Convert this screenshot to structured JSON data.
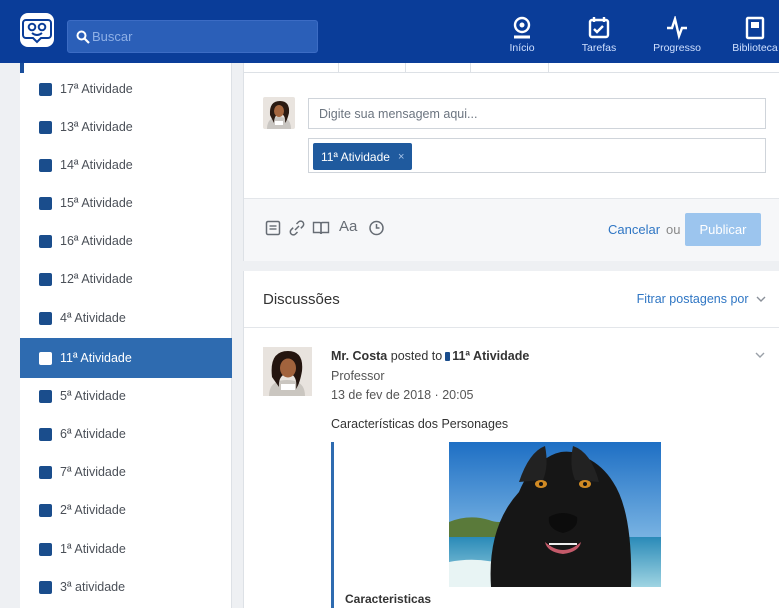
{
  "search": {
    "placeholder": "Buscar"
  },
  "nav": [
    {
      "label": "Início",
      "icon": "home-icon"
    },
    {
      "label": "Tarefas",
      "icon": "tasks-icon"
    },
    {
      "label": "Progresso",
      "icon": "progress-icon"
    },
    {
      "label": "Biblioteca",
      "icon": "library-icon"
    }
  ],
  "sidebar": {
    "items": [
      {
        "label": "17ª Atividade",
        "active": false
      },
      {
        "label": "13ª Atividade",
        "active": false
      },
      {
        "label": "14ª Atividade",
        "active": false
      },
      {
        "label": "15ª Atividade",
        "active": false
      },
      {
        "label": "16ª Atividade",
        "active": false
      },
      {
        "label": "12ª Atividade",
        "active": false
      },
      {
        "label": "4ª Atividade",
        "active": false
      },
      {
        "label": "11ª Atividade",
        "active": true
      },
      {
        "label": "5ª Atividade",
        "active": false
      },
      {
        "label": "6ª Atividade",
        "active": false
      },
      {
        "label": "7ª Atividade",
        "active": false
      },
      {
        "label": "2ª Atividade",
        "active": false
      },
      {
        "label": "1ª Atividade",
        "active": false
      },
      {
        "label": "3ª atividade",
        "active": false
      }
    ]
  },
  "compose": {
    "message_placeholder": "Digite sua mensagem aqui...",
    "tag_label": "11ª Atividade",
    "tag_remove": "×",
    "font_tool": "Aa",
    "cancel_label": "Cancelar",
    "or_label": "ou",
    "publish_label": "Publicar"
  },
  "feed": {
    "title": "Discussões",
    "filter_label": "Fitrar postagens por",
    "post": {
      "author": "Mr. Costa",
      "posted_to": "posted to",
      "group": "11ª Atividade",
      "role": "Professor",
      "date": "13 de fev de 2018 · 20:05",
      "text": "Características dos Personages",
      "attachment_title": "Caracteristicas"
    }
  },
  "colors": {
    "topbar": "#0a3d99",
    "active_item": "#2e6bb0",
    "link": "#2f76c4",
    "publish_disabled": "#9cc5ee"
  }
}
